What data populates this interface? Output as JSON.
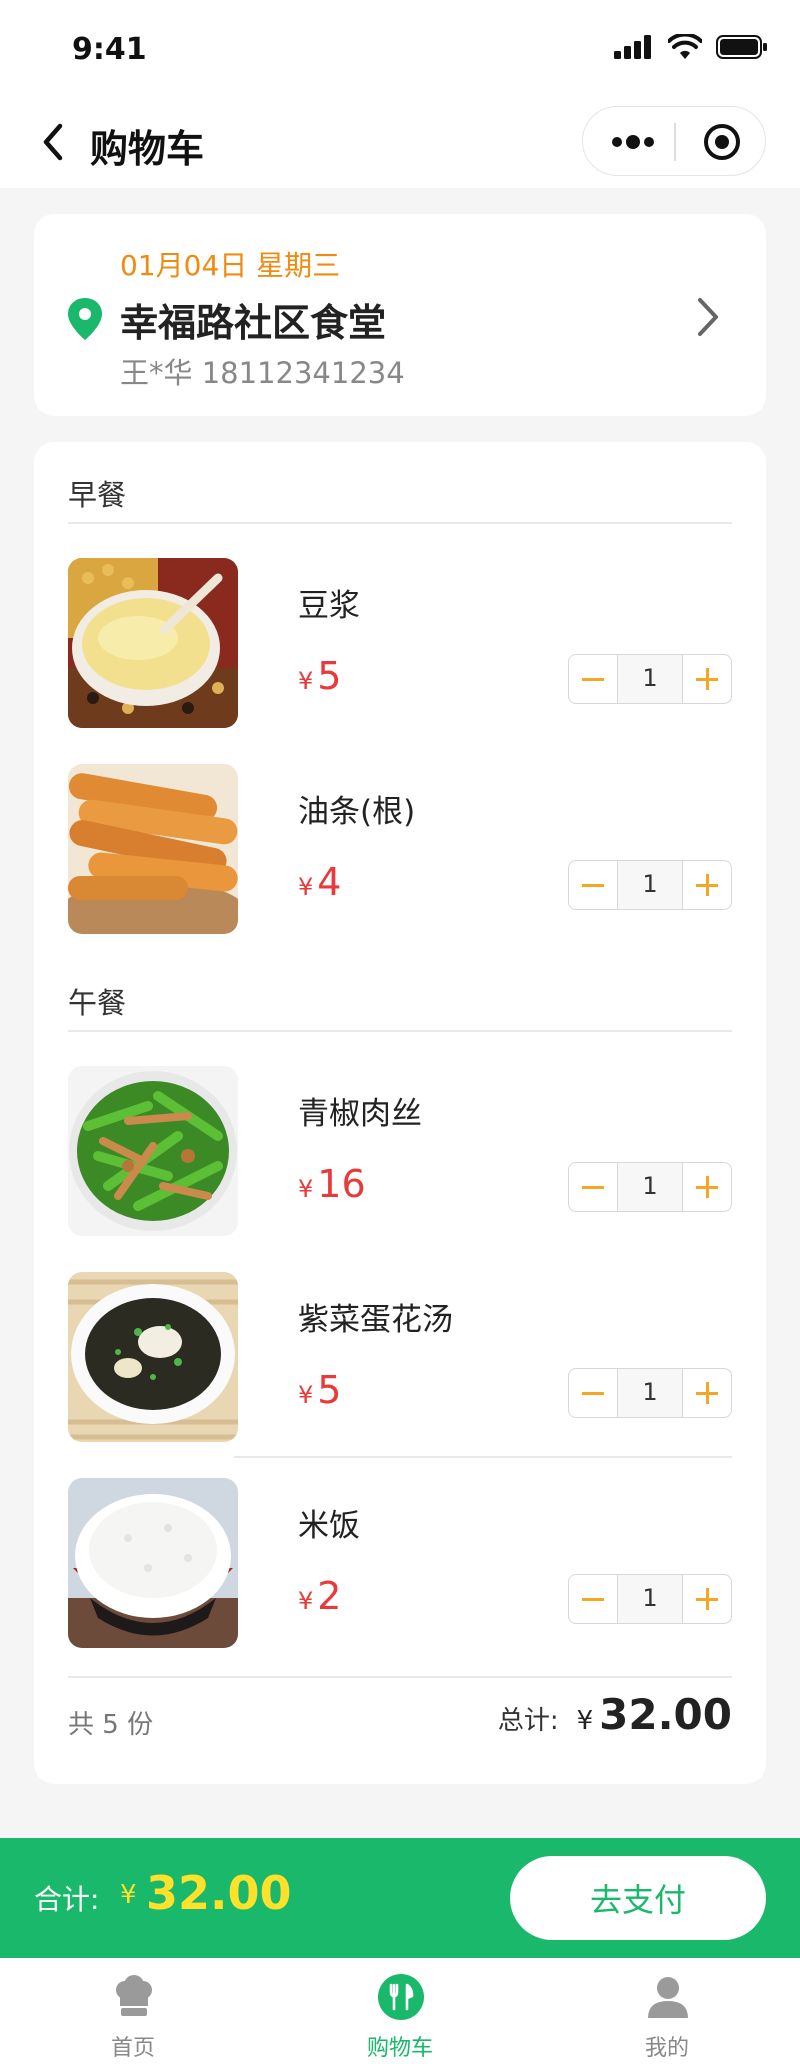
{
  "status_bar": {
    "time": "9:41"
  },
  "nav": {
    "title": "购物车"
  },
  "address": {
    "date": "01月04日  星期三",
    "canteen": "幸福路社区食堂",
    "contact": "王*华  18112341234"
  },
  "sections": [
    {
      "title": "早餐",
      "items": [
        {
          "name": "豆浆",
          "currency": "¥",
          "price": "5",
          "qty": "1",
          "image": "soy-milk"
        },
        {
          "name": "油条(根)",
          "currency": "¥",
          "price": "4",
          "qty": "1",
          "image": "fried-dough-stick"
        }
      ]
    },
    {
      "title": "午餐",
      "items": [
        {
          "name": "青椒肉丝",
          "currency": "¥",
          "price": "16",
          "qty": "1",
          "image": "green-pepper-pork"
        },
        {
          "name": "紫菜蛋花汤",
          "currency": "¥",
          "price": "5",
          "qty": "1",
          "image": "seaweed-egg-soup"
        },
        {
          "name": "米饭",
          "currency": "¥",
          "price": "2",
          "qty": "1",
          "image": "rice-bowl"
        }
      ]
    }
  ],
  "summary": {
    "count_text": "共 5 份",
    "total_label": "总计:",
    "currency": "¥",
    "total": "32.00"
  },
  "checkout": {
    "label": "合计:",
    "currency": "¥",
    "amount": "32.00",
    "pay_label": "去支付"
  },
  "tabs": [
    {
      "label": "首页",
      "icon": "chef-hat-icon",
      "active": false
    },
    {
      "label": "购物车",
      "icon": "fork-knife-icon",
      "active": true
    },
    {
      "label": "我的",
      "icon": "user-icon",
      "active": false
    }
  ],
  "colors": {
    "brand_green": "#19b86b",
    "accent_orange": "#f08b12",
    "price_red": "#e83a3a",
    "stepper_orange": "#f5a623",
    "total_yellow": "#ffe02a"
  }
}
